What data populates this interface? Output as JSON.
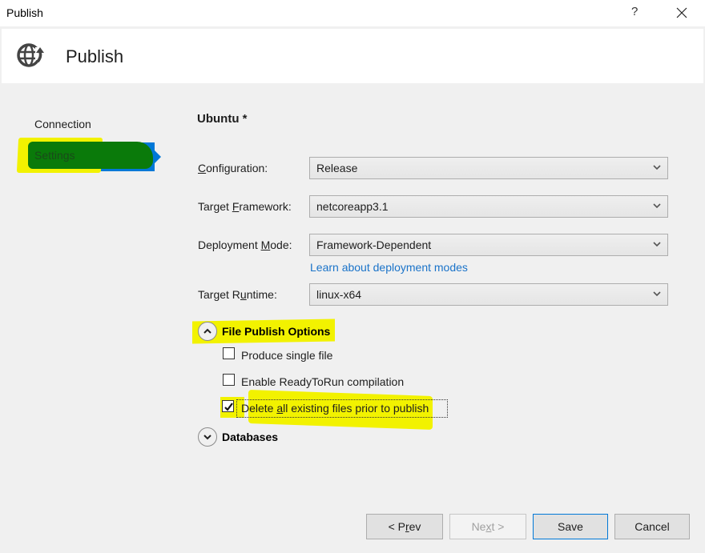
{
  "window": {
    "title": "Publish",
    "help_label": "?",
    "close_icon": "close-icon"
  },
  "header": {
    "icon": "globe-publish-icon",
    "title": "Publish"
  },
  "sidebar": {
    "items": [
      {
        "label": "Connection",
        "selected": false
      },
      {
        "label": "Settings",
        "selected": true
      }
    ]
  },
  "main": {
    "profile_title": "Ubuntu *",
    "fields": [
      {
        "label_pre": "",
        "label_key": "C",
        "label_post": "onfiguration:",
        "value": "Release"
      },
      {
        "label_pre": "Target ",
        "label_key": "F",
        "label_post": "ramework:",
        "value": "netcoreapp3.1"
      },
      {
        "label_pre": "Deployment ",
        "label_key": "M",
        "label_post": "ode:",
        "value": "Framework-Dependent"
      },
      {
        "label_pre": "Target R",
        "label_key": "u",
        "label_post": "ntime:",
        "value": "linux-x64"
      }
    ],
    "deployment_link": "Learn about deployment modes",
    "file_publish_options": {
      "title": "File Publish Options",
      "expanded": true,
      "options": [
        {
          "label_pre": "Produce single file",
          "label_key": "",
          "label_post": "",
          "checked": false
        },
        {
          "label_pre": "Enable ReadyToRun compilation",
          "label_key": "",
          "label_post": "",
          "checked": false
        },
        {
          "label_pre": "Delete ",
          "label_key": "a",
          "label_post": "ll existing files prior to publish",
          "checked": true
        }
      ]
    },
    "databases": {
      "title": "Databases",
      "expanded": false
    }
  },
  "buttons": {
    "prev": {
      "pre": "< P",
      "key": "r",
      "post": "ev"
    },
    "next": {
      "pre": "Ne",
      "key": "x",
      "post": "t >"
    },
    "save": "Save",
    "cancel": "Cancel"
  },
  "colors": {
    "accent": "#0078d7",
    "link": "#1a73c9",
    "highlight": "#f2f200",
    "redaction": "#0a7a0a"
  }
}
